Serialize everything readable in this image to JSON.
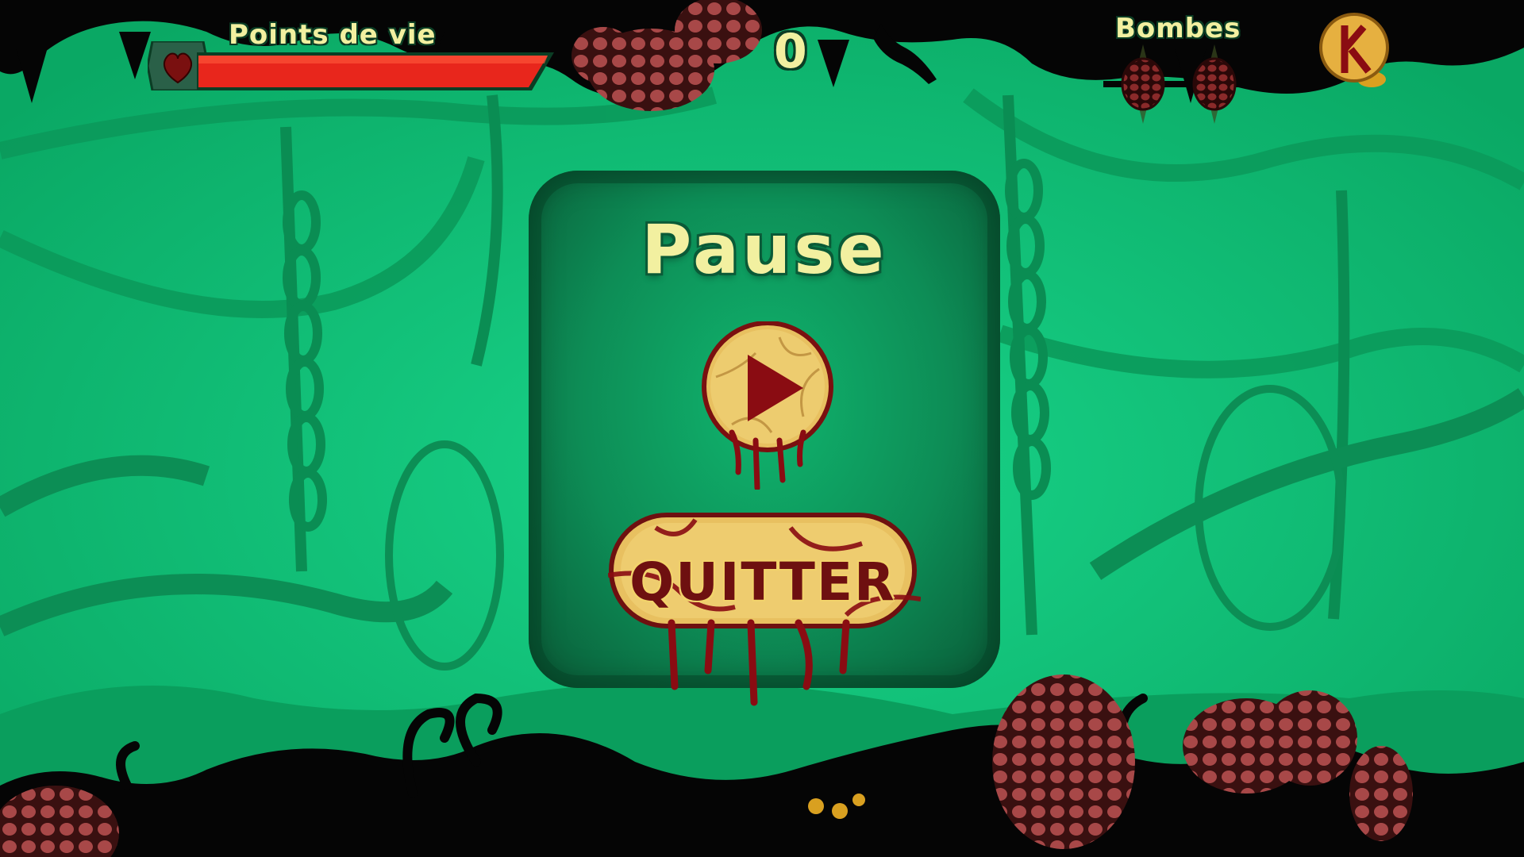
{
  "hud": {
    "health_label": "Points de vie",
    "health_fraction": 1.0,
    "score": "0",
    "bombs_label": "Bombes",
    "bomb_count": 2
  },
  "pause_menu": {
    "title": "Pause",
    "quit_label": "QUITTER"
  },
  "icons": {
    "heart": "heart-icon",
    "resume": "play-icon",
    "bomb": "bomb-egg-icon",
    "special": "special-bomb-icon"
  },
  "colors": {
    "background": "#0fbf73",
    "panel": "#0d8d56",
    "health_bar": "#e8261c",
    "hud_text": "#f2f0a0",
    "gold": "#e6c060",
    "blood": "#8a0c12"
  }
}
